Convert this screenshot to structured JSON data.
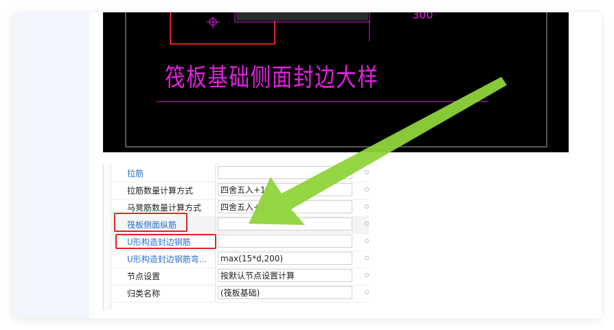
{
  "drawing": {
    "title": "筏板基础侧面封边大样",
    "dim_text": "300"
  },
  "properties": {
    "rows": [
      {
        "name": "拉筋",
        "value": "",
        "link": true
      },
      {
        "name": "拉筋数量计算方式",
        "value": "四舍五入+1",
        "link": false
      },
      {
        "name": "马凳筋数量计算方式",
        "value": "四舍五入+1",
        "link": false
      },
      {
        "name": "筏板侧面纵筋",
        "value": "",
        "link": true
      },
      {
        "name": "U形构造封边钢筋",
        "value": "",
        "link": true
      },
      {
        "name": "U形构造封边钢筋弯...",
        "value": "max(15*d,200)",
        "link": true
      },
      {
        "name": "节点设置",
        "value": "按默认节点设置计算",
        "link": false
      },
      {
        "name": "归类名称",
        "value": "(筏板基础)",
        "link": false
      }
    ]
  },
  "colors": {
    "cad_line": "#e020e0",
    "highlight": "#e62020",
    "arrow": "#8ed43a"
  }
}
